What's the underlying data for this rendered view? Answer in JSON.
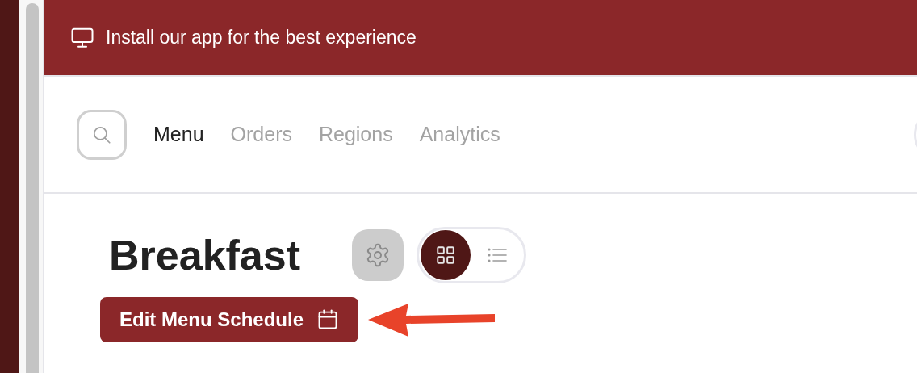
{
  "banner": {
    "text": "Install our app for the best experience"
  },
  "nav": {
    "tabs": [
      {
        "label": "Menu",
        "selected": true
      },
      {
        "label": "Orders",
        "selected": false
      },
      {
        "label": "Regions",
        "selected": false
      },
      {
        "label": "Analytics",
        "selected": false
      }
    ]
  },
  "page": {
    "title": "Breakfast",
    "view_toggle": [
      {
        "kind": "grid",
        "selected": true
      },
      {
        "kind": "list",
        "selected": false
      }
    ],
    "schedule_button": {
      "label": "Edit Menu Schedule"
    }
  }
}
